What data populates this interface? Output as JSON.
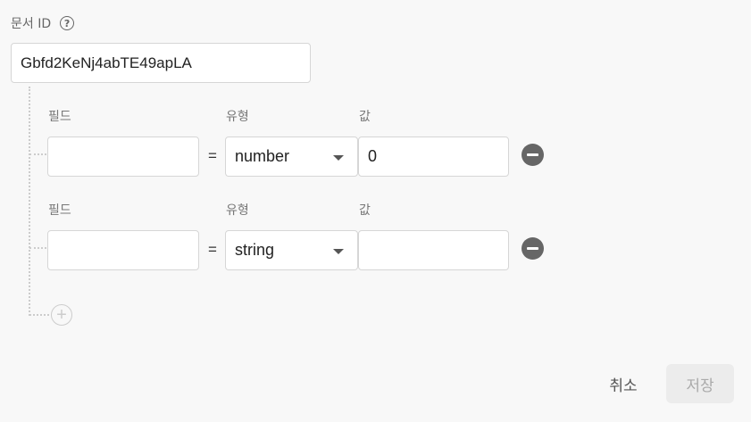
{
  "doc_id": {
    "label": "문서 ID",
    "help_icon": "help-circle-icon",
    "value": "Gbfd2KeNj4abTE49apLA"
  },
  "fields": [
    {
      "field_label": "필드",
      "type_label": "유형",
      "value_label": "값",
      "field_value": "",
      "equals": "=",
      "type_value": "number",
      "value": "0"
    },
    {
      "field_label": "필드",
      "type_label": "유형",
      "value_label": "값",
      "field_value": "",
      "equals": "=",
      "type_value": "string",
      "value": ""
    }
  ],
  "add_field_icon": "plus-circle-icon",
  "remove_field_icon": "minus-circle-icon",
  "actions": {
    "cancel": "취소",
    "save": "저장"
  },
  "colors": {
    "background": "#f8f8f8",
    "remove_button": "#666666",
    "save_disabled_bg": "#ececec"
  }
}
